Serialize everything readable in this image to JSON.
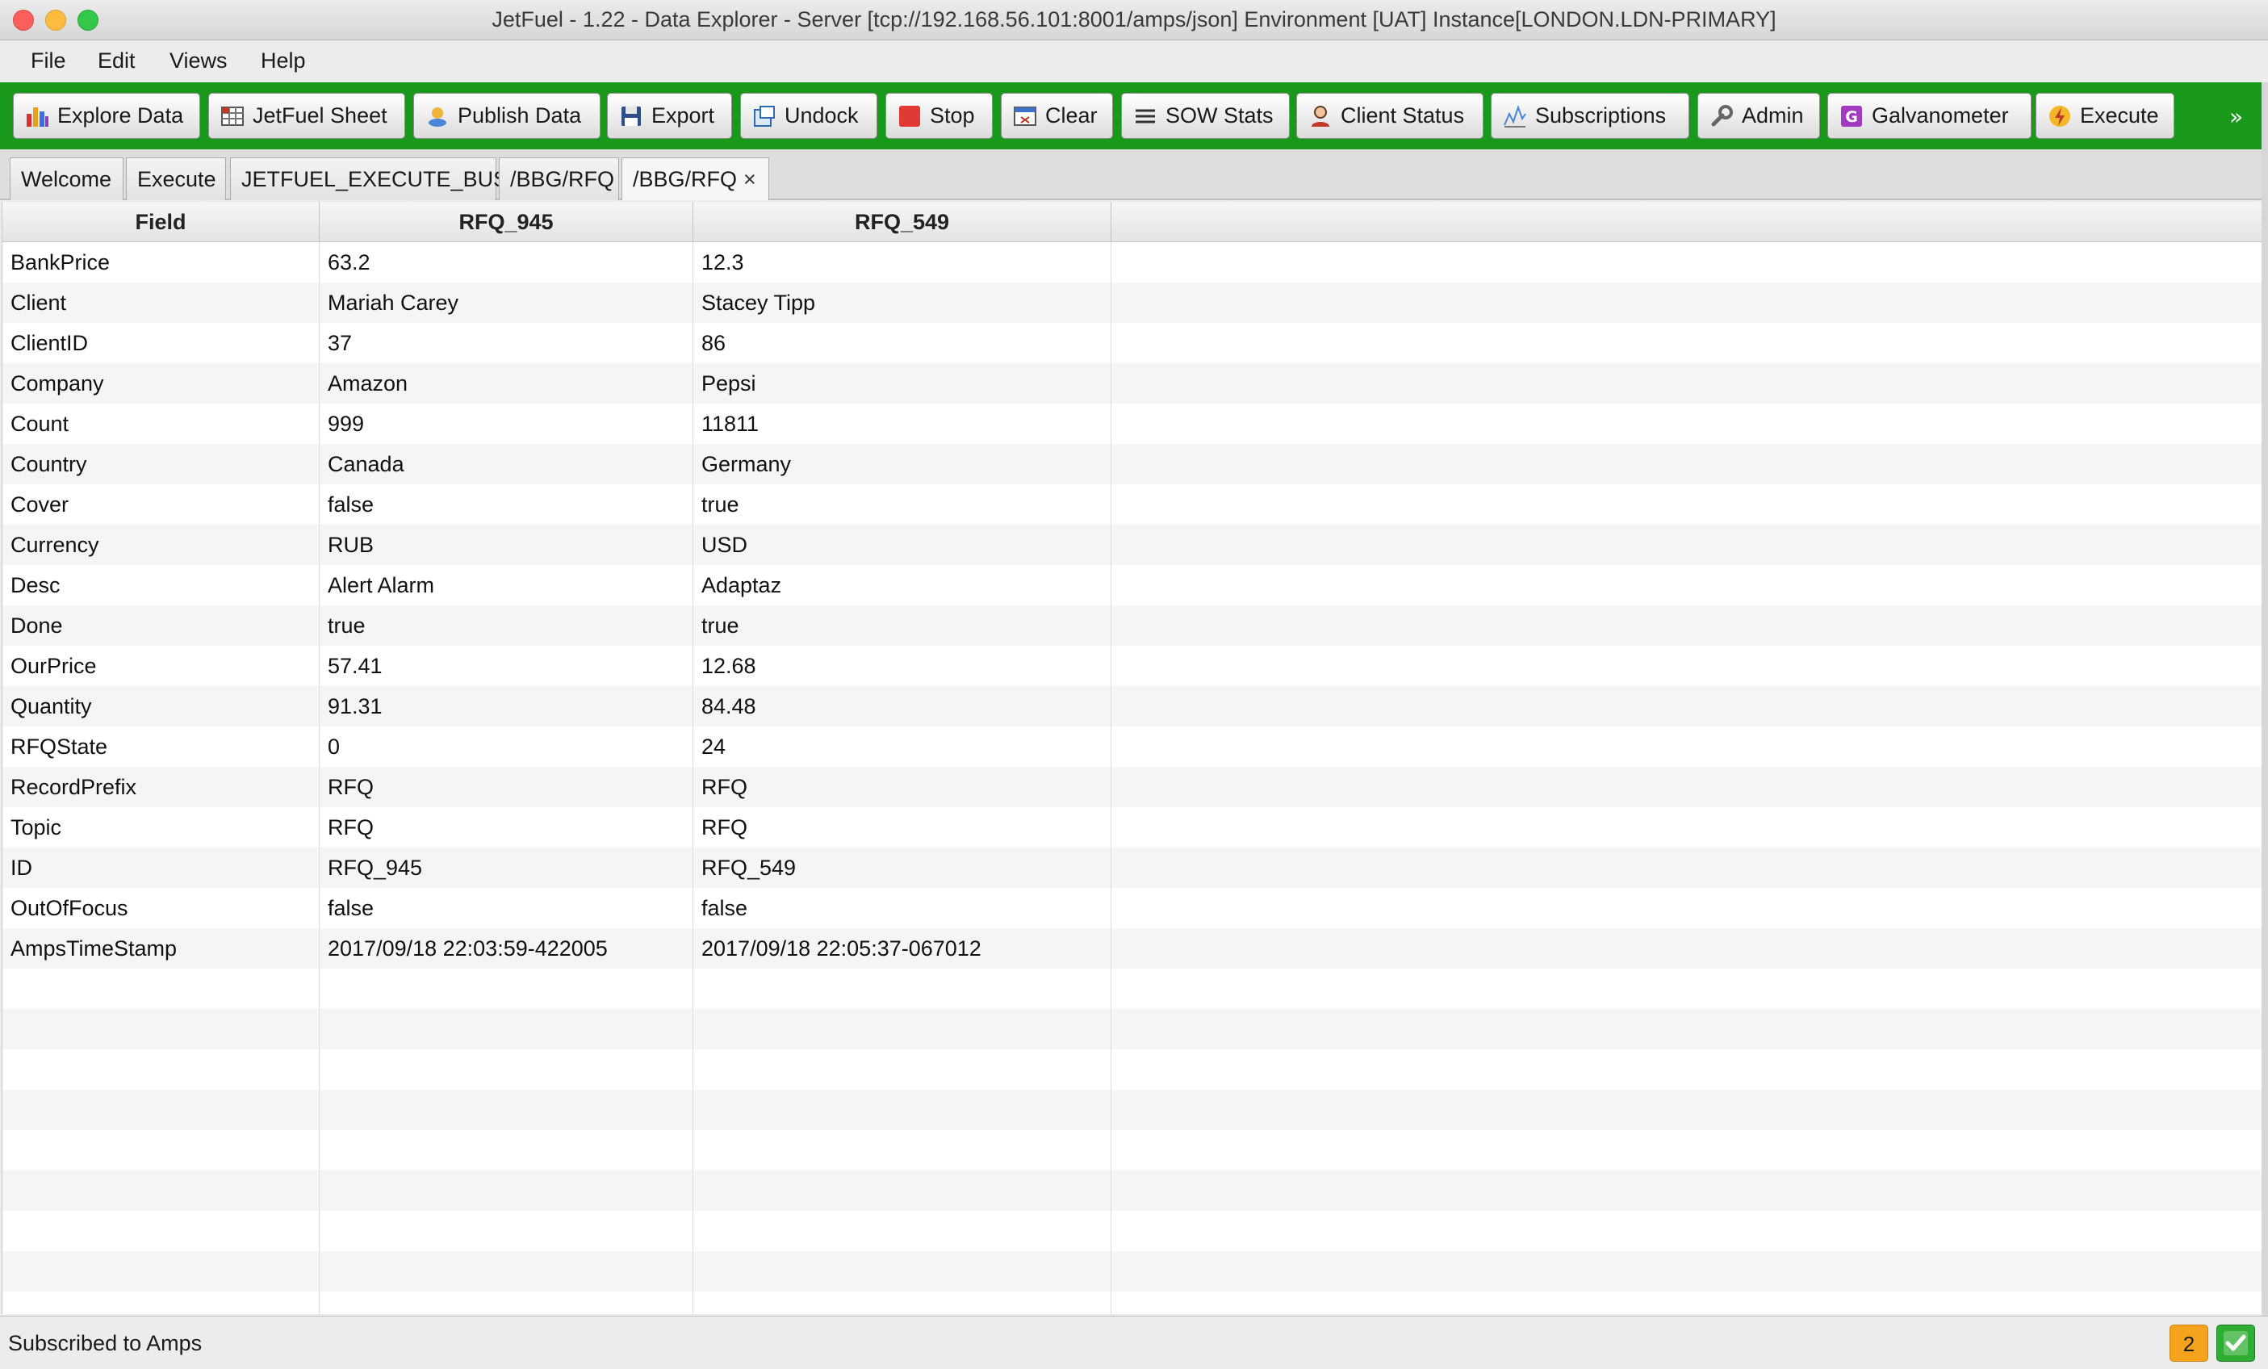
{
  "window": {
    "title": "JetFuel - 1.22 - Data Explorer - Server [tcp://192.168.56.101:8001/amps/json] Environment [UAT] Instance[LONDON.LDN-PRIMARY]"
  },
  "menu": {
    "items": [
      {
        "label": "File"
      },
      {
        "label": "Edit"
      },
      {
        "label": "Views"
      },
      {
        "label": "Help"
      }
    ]
  },
  "toolbar": {
    "buttons": [
      {
        "label": "Explore Data",
        "icon": "bar-chart-icon"
      },
      {
        "label": "JetFuel Sheet",
        "icon": "spreadsheet-icon"
      },
      {
        "label": "Publish Data",
        "icon": "publish-icon"
      },
      {
        "label": "Export",
        "icon": "floppy-disk-icon"
      },
      {
        "label": "Undock",
        "icon": "undock-icon"
      },
      {
        "label": "Stop",
        "icon": "stop-icon"
      },
      {
        "label": "Clear",
        "icon": "clear-window-icon"
      },
      {
        "label": "SOW Stats",
        "icon": "list-lines-icon"
      },
      {
        "label": "Client Status",
        "icon": "person-icon"
      },
      {
        "label": "Subscriptions",
        "icon": "signal-chart-icon"
      },
      {
        "label": "Admin",
        "icon": "wrench-icon"
      },
      {
        "label": "Galvanometer",
        "icon": "galvanometer-g-icon"
      },
      {
        "label": "Execute",
        "icon": "lightning-icon"
      }
    ],
    "overflow": "»"
  },
  "tabs": [
    {
      "label": "Welcome"
    },
    {
      "label": "Execute"
    },
    {
      "label": "JETFUEL_EXECUTE_BUS"
    },
    {
      "label": "/BBG/RFQ"
    },
    {
      "label": "/BBG/RFQ",
      "active": true,
      "close": "×"
    }
  ],
  "grid": {
    "columns": [
      "Field",
      "RFQ_945",
      "RFQ_549"
    ],
    "rows": [
      [
        "BankPrice",
        "63.2",
        "12.3"
      ],
      [
        "Client",
        "Mariah Carey",
        "Stacey Tipp"
      ],
      [
        "ClientID",
        "37",
        "86"
      ],
      [
        "Company",
        "Amazon",
        "Pepsi"
      ],
      [
        "Count",
        "999",
        "11811"
      ],
      [
        "Country",
        "Canada",
        "Germany"
      ],
      [
        "Cover",
        "false",
        "true"
      ],
      [
        "Currency",
        "RUB",
        "USD"
      ],
      [
        "Desc",
        "Alert Alarm",
        "Adaptaz"
      ],
      [
        "Done",
        "true",
        "true"
      ],
      [
        "OurPrice",
        "57.41",
        "12.68"
      ],
      [
        "Quantity",
        "91.31",
        "84.48"
      ],
      [
        "RFQState",
        "0",
        "24"
      ],
      [
        "RecordPrefix",
        "RFQ",
        "RFQ"
      ],
      [
        "Topic",
        "RFQ",
        "RFQ"
      ],
      [
        "ID",
        "RFQ_945",
        "RFQ_549"
      ],
      [
        "OutOfFocus",
        "false",
        "false"
      ],
      [
        "AmpsTimeStamp",
        "2017/09/18 22:03:59-422005",
        "2017/09/18 22:05:37-067012"
      ]
    ]
  },
  "status": {
    "text": "Subscribed to Amps",
    "count": "2",
    "ok_icon": "green-check-icon"
  },
  "colors": {
    "toolbar_bg": "#199919",
    "status_badge": "#f5a21c",
    "status_ok": "#2fae33"
  }
}
